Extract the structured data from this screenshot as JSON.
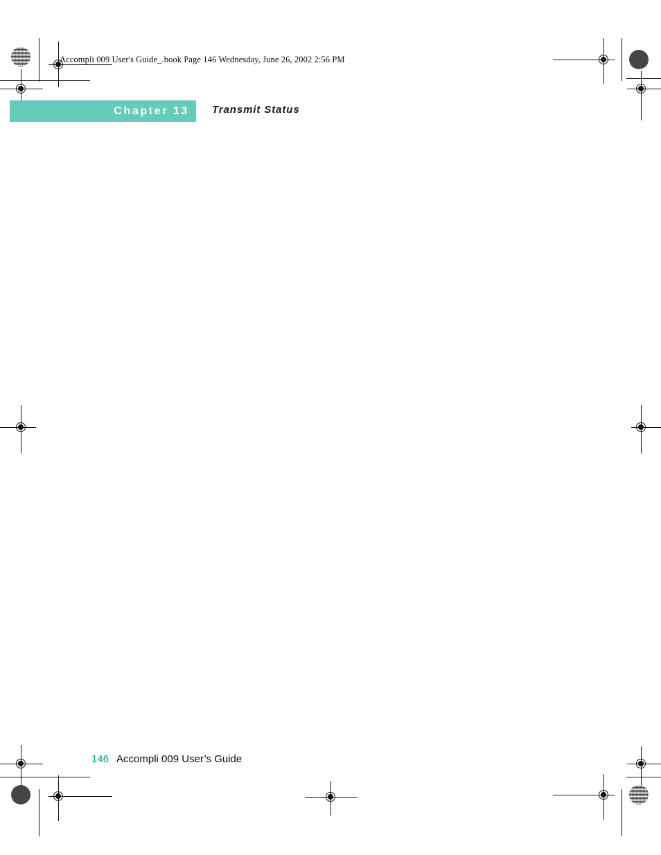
{
  "document": {
    "book_header": "Accompli 009 User's Guide_.book  Page 146  Wednesday, June 26, 2002  2:56 PM",
    "chapter_label": "Chapter 13",
    "chapter_title": "Transmit Status",
    "body_text": ""
  },
  "footer": {
    "page_number": "146",
    "guide_title": "Accompli 009 User’s Guide"
  },
  "colors": {
    "banner_teal": "#65cbba",
    "page_number_teal": "#00a98e",
    "text_black": "#0a0a0a",
    "mark_black": "#111111",
    "page_white": "#ffffff"
  }
}
